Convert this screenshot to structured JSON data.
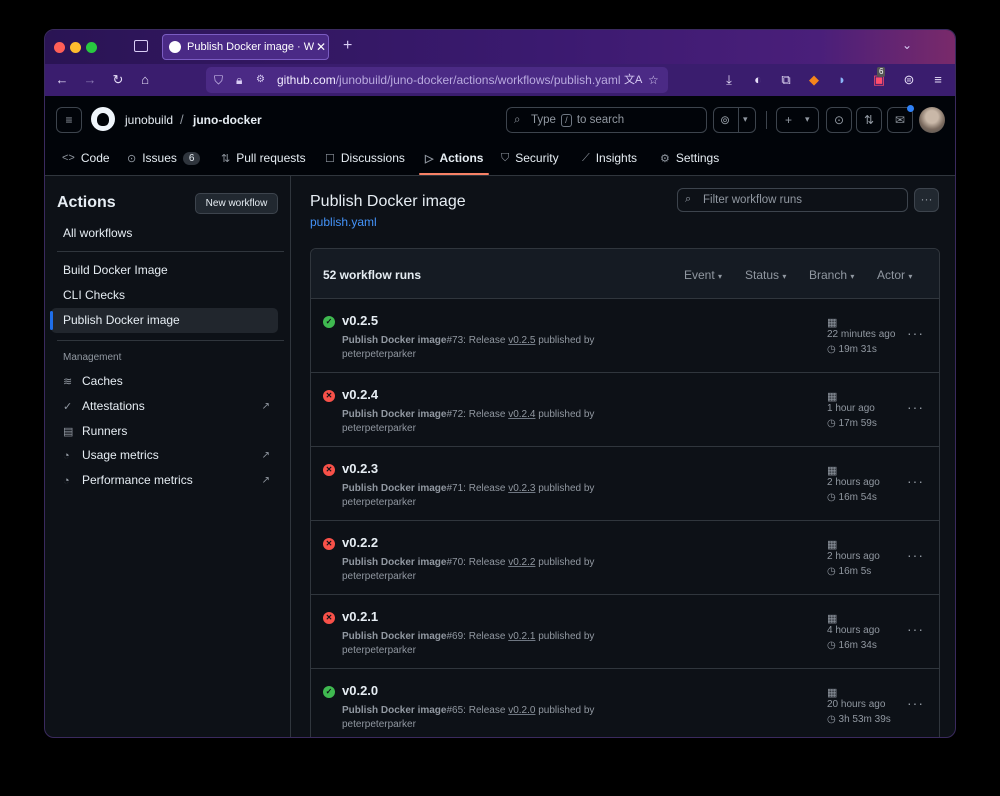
{
  "browser": {
    "tab_title": "Publish Docker image · Workflow",
    "url_host": "github.com",
    "url_path": "/junobuild/juno-docker/actions/workflows/publish.yaml",
    "extension_badge": "6",
    "colors": {
      "red": "#ff5f57",
      "yellow": "#febc2e",
      "green": "#28c840"
    }
  },
  "header": {
    "owner": "junobuild",
    "separator": "/",
    "repo": "juno-docker",
    "search_placeholder_a": "Type",
    "search_key": "/",
    "search_placeholder_b": "to search"
  },
  "repo_tabs": [
    {
      "label": "Code",
      "icon": "code-icon"
    },
    {
      "label": "Issues",
      "icon": "issue-icon",
      "count": "6"
    },
    {
      "label": "Pull requests",
      "icon": "pull-request-icon"
    },
    {
      "label": "Discussions",
      "icon": "discussion-icon"
    },
    {
      "label": "Actions",
      "icon": "play-icon",
      "active": true
    },
    {
      "label": "Security",
      "icon": "shield-icon"
    },
    {
      "label": "Insights",
      "icon": "graph-icon"
    },
    {
      "label": "Settings",
      "icon": "gear-icon"
    }
  ],
  "sidebar": {
    "title": "Actions",
    "new_workflow": "New workflow",
    "all_workflows": "All workflows",
    "workflows": [
      "Build Docker Image",
      "CLI Checks",
      "Publish Docker image"
    ],
    "management_label": "Management",
    "management": [
      {
        "label": "Caches",
        "icon": "database-icon"
      },
      {
        "label": "Attestations",
        "icon": "verified-icon",
        "external": true
      },
      {
        "label": "Runners",
        "icon": "server-icon"
      },
      {
        "label": "Usage metrics",
        "icon": "meter-icon",
        "external": true
      },
      {
        "label": "Performance metrics",
        "icon": "meter-icon",
        "external": true
      }
    ]
  },
  "main": {
    "title": "Publish Docker image",
    "file_link": "publish.yaml",
    "filter_placeholder": "Filter workflow runs",
    "run_count": "52 workflow runs",
    "filters": [
      "Event",
      "Status",
      "Branch",
      "Actor"
    ],
    "runs": [
      {
        "title": "v0.2.5",
        "status": "success",
        "workflow": "Publish Docker image",
        "number": "#73",
        "tag": "v0.2.5",
        "actor": "peterpeterparker",
        "ago": "22 minutes ago",
        "duration": "19m 31s"
      },
      {
        "title": "v0.2.4",
        "status": "failure",
        "workflow": "Publish Docker image",
        "number": "#72",
        "tag": "v0.2.4",
        "actor": "peterpeterparker",
        "ago": "1 hour ago",
        "duration": "17m 59s"
      },
      {
        "title": "v0.2.3",
        "status": "failure",
        "workflow": "Publish Docker image",
        "number": "#71",
        "tag": "v0.2.3",
        "actor": "peterpeterparker",
        "ago": "2 hours ago",
        "duration": "16m 54s"
      },
      {
        "title": "v0.2.2",
        "status": "failure",
        "workflow": "Publish Docker image",
        "number": "#70",
        "tag": "v0.2.2",
        "actor": "peterpeterparker",
        "ago": "2 hours ago",
        "duration": "16m 5s"
      },
      {
        "title": "v0.2.1",
        "status": "failure",
        "workflow": "Publish Docker image",
        "number": "#69",
        "tag": "v0.2.1",
        "actor": "peterpeterparker",
        "ago": "4 hours ago",
        "duration": "16m 34s"
      },
      {
        "title": "v0.2.0",
        "status": "success",
        "workflow": "Publish Docker image",
        "number": "#65",
        "tag": "v0.2.0",
        "actor": "peterpeterparker",
        "ago": "20 hours ago",
        "duration": "3h 53m 39s"
      }
    ],
    "text": {
      "release": "Release",
      "published_by": "published by"
    },
    "status_colors": {
      "success": "#3fb950",
      "failure": "#f85149"
    }
  }
}
